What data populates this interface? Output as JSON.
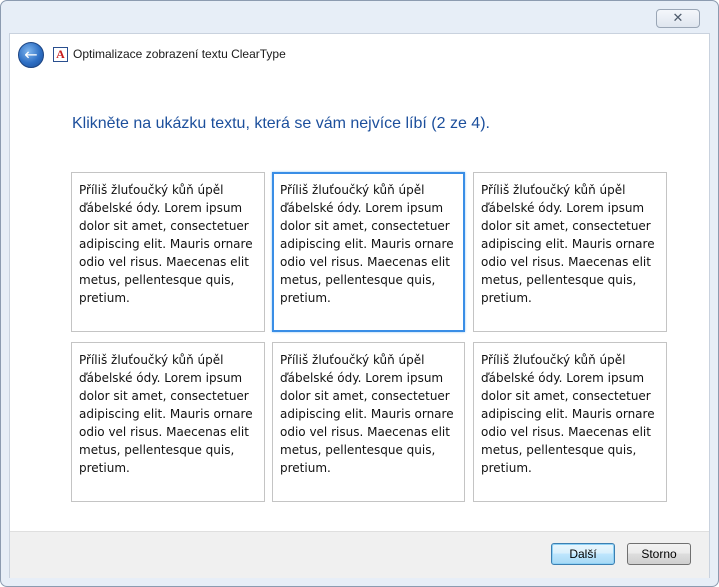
{
  "window": {
    "title": "Optimalizace zobrazení textu ClearType",
    "close_glyph": "✕",
    "app_icon_letter": "A"
  },
  "back_button": {
    "glyph": "←",
    "icon": "back-arrow-icon"
  },
  "main": {
    "heading": "Klikněte na ukázku textu, která se vám nejvíce líbí (2 ze 4).",
    "selected_index": 2,
    "samples": [
      {
        "text": "Příliš žluťoučký kůň úpěl ďábelské ódy. Lorem ipsum dolor sit amet, consectetuer adipiscing elit. Mauris ornare odio vel risus. Maecenas elit metus, pellentesque quis, pretium."
      },
      {
        "text": "Příliš žluťoučký kůň úpěl ďábelské ódy. Lorem ipsum dolor sit amet, consectetuer adipiscing elit. Mauris ornare odio vel risus. Maecenas elit metus, pellentesque quis, pretium."
      },
      {
        "text": "Příliš žluťoučký kůň úpěl ďábelské ódy. Lorem ipsum dolor sit amet, consectetuer adipiscing elit. Mauris ornare odio vel risus. Maecenas elit metus, pellentesque quis, pretium."
      },
      {
        "text": "Příliš žluťoučký kůň úpěl ďábelské ódy. Lorem ipsum dolor sit amet, consectetuer adipiscing elit. Mauris ornare odio vel risus. Maecenas elit metus, pellentesque quis, pretium."
      },
      {
        "text": "Příliš žluťoučký kůň úpěl ďábelské ódy. Lorem ipsum dolor sit amet, consectetuer adipiscing elit. Mauris ornare odio vel risus. Maecenas elit metus, pellentesque quis, pretium."
      },
      {
        "text": "Příliš žluťoučký kůň úpěl ďábelské ódy. Lorem ipsum dolor sit amet, consectetuer adipiscing elit. Mauris ornare odio vel risus. Maecenas elit metus, pellentesque quis, pretium."
      }
    ]
  },
  "footer": {
    "next_label": "Další",
    "cancel_label": "Storno"
  },
  "colors": {
    "heading": "#1c4f9c",
    "selection_border": "#3a8ee6"
  }
}
